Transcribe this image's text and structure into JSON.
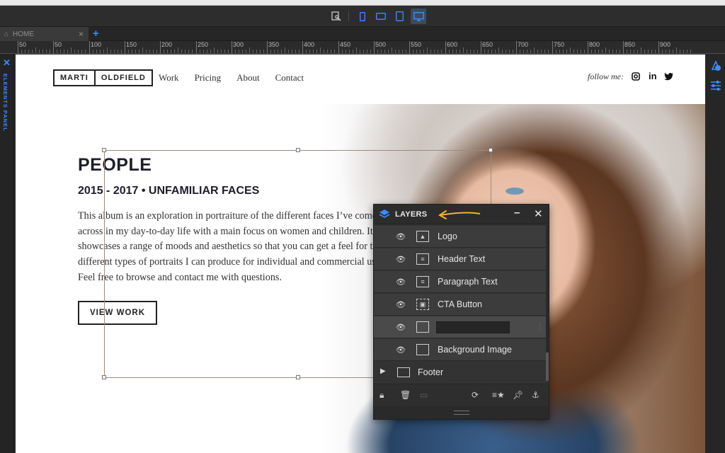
{
  "toolbar": {
    "icons": [
      "preview-icon",
      "mobile-icon",
      "tablet-landscape-icon",
      "tablet-icon",
      "desktop-icon"
    ],
    "active_device": "desktop",
    "accent_color": "#3d8bff"
  },
  "tabs": [
    {
      "label": "HOME",
      "icon": "home-icon"
    }
  ],
  "ruler": {
    "labels": [
      "50",
      "50",
      "100",
      "150",
      "200",
      "250",
      "300",
      "350",
      "400",
      "450",
      "500",
      "550",
      "600",
      "650",
      "700",
      "750",
      "800",
      "850",
      "900"
    ]
  },
  "left_panel": {
    "label": "ELEMENTS PANEL"
  },
  "site": {
    "logo_left": "MARTI",
    "logo_right": "OLDFIELD",
    "nav": [
      "Work",
      "Pricing",
      "About",
      "Contact"
    ],
    "follow_label": "follow me:",
    "social": [
      "instagram-icon",
      "linkedin-icon",
      "twitter-icon"
    ],
    "title": "PEOPLE",
    "subtitle": "2015 - 2017  •  UNFAMILIAR FACES",
    "paragraph": "This album is an exploration in portraiture of the different faces I’ve come across in my day-to-day life with a main focus on women and children. It showcases a range of moods and aesthetics so that you can get a feel for the different types of portraits I can produce for individual and commercial use. Feel free to browse and contact me with questions.",
    "cta": "VIEW WORK"
  },
  "layers_panel": {
    "title": "LAYERS",
    "layers": [
      {
        "name": "Logo",
        "icon": "image-icon"
      },
      {
        "name": "Header Text",
        "icon": "text-icon"
      },
      {
        "name": "Paragraph Text",
        "icon": "text-icon"
      },
      {
        "name": "CTA Button",
        "icon": "button-icon"
      },
      {
        "name": "",
        "icon": "box-icon",
        "editing": true
      },
      {
        "name": "Background Image",
        "icon": "box-icon"
      }
    ],
    "footer_group": "Footer",
    "tools": [
      "lock-icon",
      "trash-icon",
      "folder-icon",
      "sync-icon",
      "star-list-icon",
      "pin-icon",
      "anchor-icon"
    ]
  }
}
